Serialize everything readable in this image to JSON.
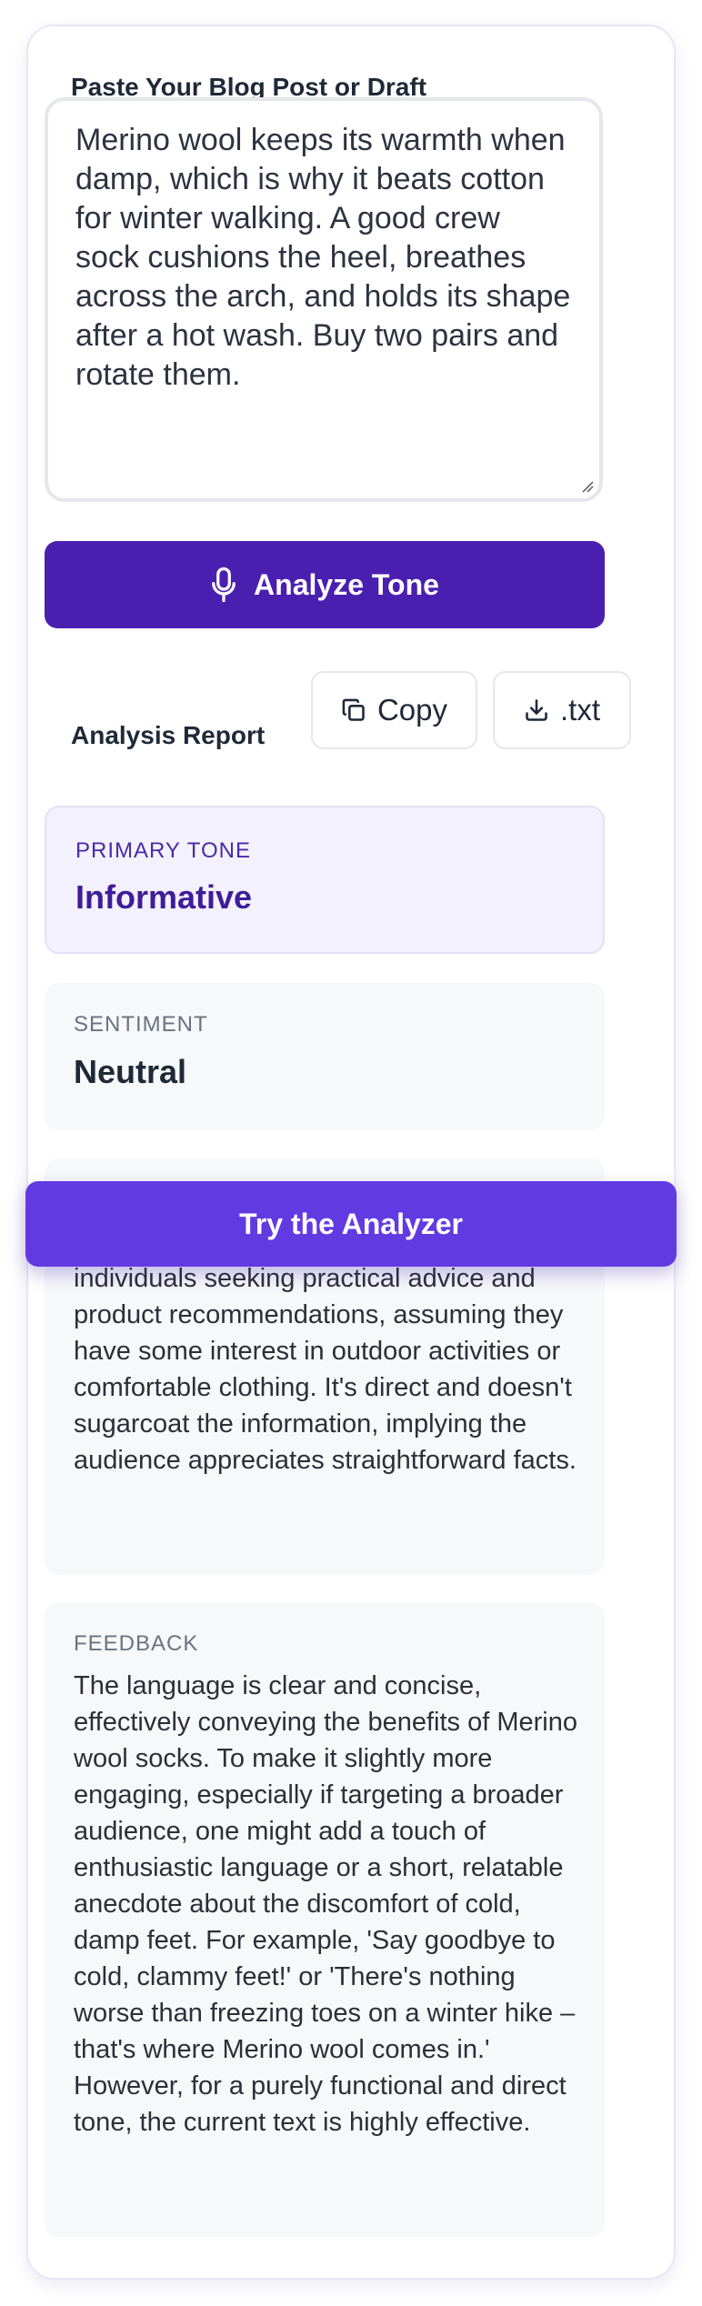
{
  "input": {
    "label": "Paste Your Blog Post or Draft",
    "value": "Merino wool keeps its warmth when damp, which is why it beats cotton for winter walking. A good crew sock cushions the heel, breathes across the arch, and holds its shape after a hot wash. Buy two pairs and rotate them."
  },
  "actions": {
    "analyze_label": "Analyze Tone",
    "analyze_icon": "microphone-icon"
  },
  "report": {
    "title": "Analysis Report",
    "copy_label": "Copy",
    "copy_icon": "copy-icon",
    "download_label": ".txt",
    "download_icon": "download-icon",
    "primary_tone": {
      "key": "PRIMARY TONE",
      "value": "Informative"
    },
    "sentiment": {
      "key": "SENTIMENT",
      "value": "Neutral"
    },
    "audience_text": "individuals seeking practical advice and product recommendations, assuming they have some interest in outdoor activities or comfortable clothing. It's direct and doesn't sugarcoat the information, implying the audience appreciates straightforward facts.",
    "feedback": {
      "key": "FEEDBACK",
      "text": "The language is clear and concise, effectively conveying the benefits of Merino wool socks. To make it slightly more engaging, especially if targeting a broader audience, one might add a touch of enthusiastic language or a short, relatable anecdote about the discomfort of cold, damp feet. For example, 'Say goodbye to cold, clammy feet!' or 'There's nothing worse than freezing toes on a winter hike – that's where Merino wool comes in.' However, for a purely functional and direct tone, the current text is highly effective."
    }
  },
  "cta": {
    "label": "Try the Analyzer"
  },
  "colors": {
    "brand": "#4a1fb0",
    "cta": "#623ae2",
    "tone_text": "#3f1d99",
    "tone_bg": "#f3f1fd"
  }
}
